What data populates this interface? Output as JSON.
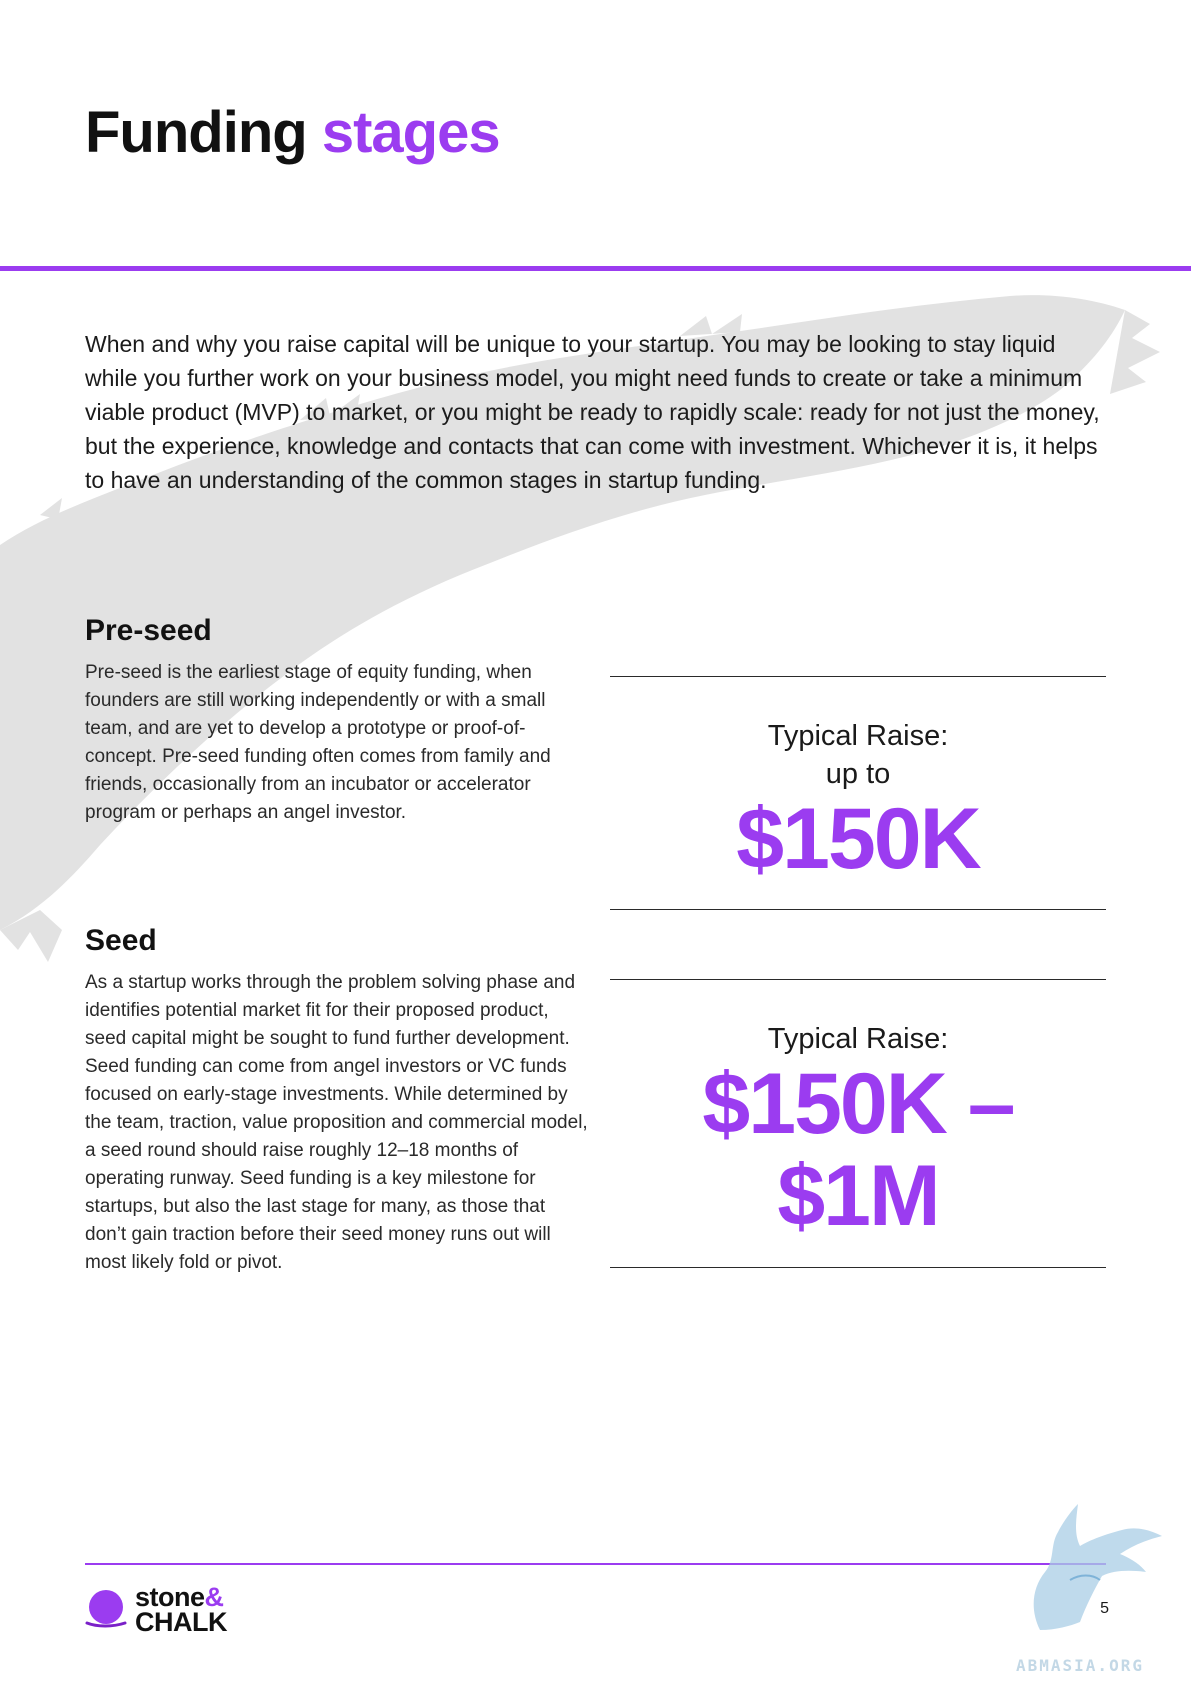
{
  "header": {
    "title_main": "Funding",
    "title_accent": "stages"
  },
  "intro": {
    "text": "When and why you raise capital will be unique to your startup. You may be looking to stay liquid while you further work on your business model, you might need funds to create or take a minimum viable product (MVP) to market, or you might be ready to rapidly scale: ready for not just the money, but the experience, knowledge and contacts that can come with investment. Whichever it is, it helps to have an understanding of the common stages in startup funding."
  },
  "sections": [
    {
      "title": "Pre-seed",
      "body": "Pre-seed is the earliest stage of equity funding, when founders are still working independently or with a small team, and are yet to develop a prototype or proof-of-concept. Pre-seed funding often comes from family and friends, occasionally from an incubator or accelerator program or perhaps an angel investor.",
      "raise_label": "Typical Raise:",
      "raise_prefix": "up to",
      "raise_amount": "$150K"
    },
    {
      "title": "Seed",
      "body": "As a startup works through the problem solving phase and identifies potential market fit for their proposed product, seed capital might be sought to fund further development. Seed funding can come from angel investors or VC funds focused on early-stage investments. While determined by the team, traction, value proposition and commercial model, a seed round should raise roughly 12–18 months of operating runway. Seed funding is a key milestone for startups, but also the last stage for many, as those that don’t gain traction before their seed money runs out will most likely fold or pivot.",
      "raise_label": "Typical Raise:",
      "raise_amount_line1": "$150K –",
      "raise_amount_line2": "$1M"
    }
  ],
  "footer": {
    "logo_word1": "stone",
    "logo_amp": "&",
    "logo_word2": "CHALK",
    "page_number": "5",
    "watermark_text": "ABMASIA.ORG"
  },
  "colors": {
    "accent": "#9b3cf0",
    "text": "#1a1a1a",
    "brush": "#e2e2e2",
    "watermark": "#a9cde6"
  },
  "icons": {
    "logo_mark": "stone-chalk-logo-icon",
    "watermark": "dragon-watermark-icon"
  }
}
